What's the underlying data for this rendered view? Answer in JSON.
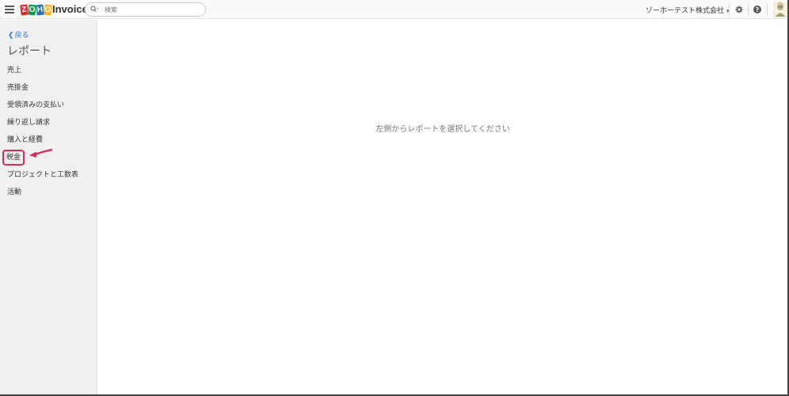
{
  "header": {
    "app_name": "Invoice",
    "logo_letters": [
      "Z",
      "O",
      "H",
      "O"
    ],
    "search_placeholder": "検索",
    "organization": "ゾーホーテスト株式会社"
  },
  "sidebar": {
    "back_label": "戻る",
    "title": "レポート",
    "items": [
      {
        "label": "売上"
      },
      {
        "label": "売掛金"
      },
      {
        "label": "受領済みの支払い"
      },
      {
        "label": "繰り返し請求"
      },
      {
        "label": "購入と経費"
      },
      {
        "label": "税金"
      },
      {
        "label": "プロジェクトと工数表"
      },
      {
        "label": "活動"
      }
    ],
    "highlighted_index": 5
  },
  "main": {
    "empty_message": "左側からレポートを選択してください"
  },
  "colors": {
    "link": "#2a72c9",
    "highlight": "#e2255b",
    "sidebar_bg": "#f0f0f0"
  },
  "icons": [
    "menu-icon",
    "search-icon",
    "gear-icon",
    "help-icon",
    "avatar-icon"
  ]
}
